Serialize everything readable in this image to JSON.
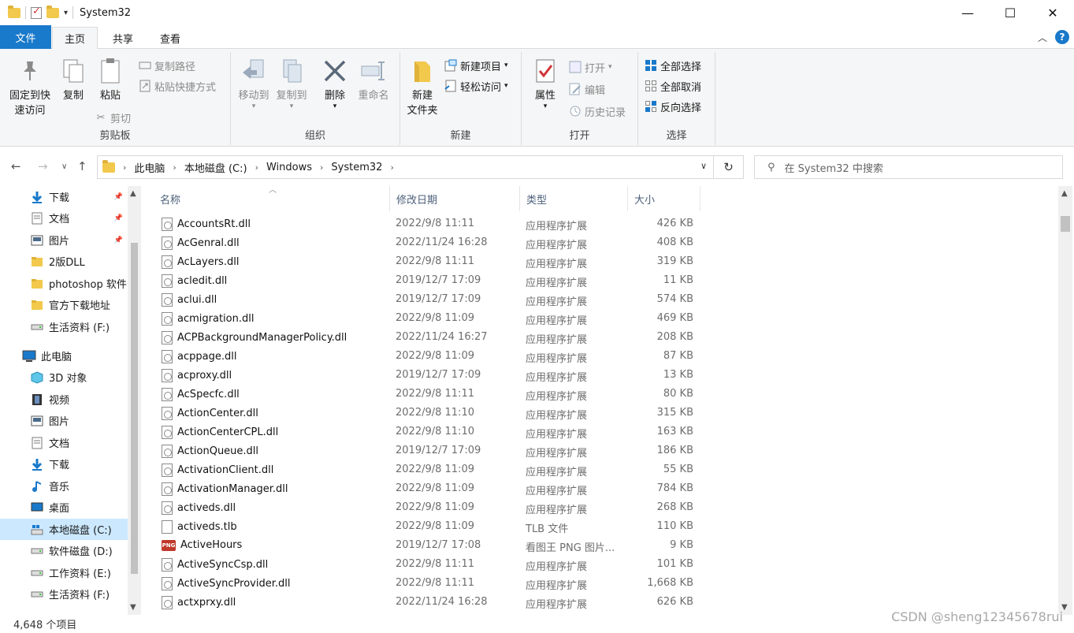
{
  "window": {
    "title": "System32",
    "controls": [
      "—",
      "☐",
      "✕"
    ]
  },
  "ribbon_tabs": {
    "file": "文件",
    "home": "主页",
    "share": "共享",
    "view": "查看"
  },
  "ribbon": {
    "clipboard": {
      "label": "剪贴板",
      "pin": "固定到快",
      "pin2": "速访问",
      "copy": "复制",
      "paste": "粘贴",
      "copy_path": "复制路径",
      "paste_shortcut": "粘贴快捷方式",
      "cut": "剪切"
    },
    "organize": {
      "label": "组织",
      "move_to": "移动到",
      "copy_to": "复制到",
      "delete": "删除",
      "rename": "重命名"
    },
    "new": {
      "label": "新建",
      "new_folder": "新建",
      "new_folder2": "文件夹",
      "new_item": "新建项目",
      "easy_access": "轻松访问"
    },
    "open": {
      "label": "打开",
      "properties": "属性",
      "open": "打开",
      "edit": "编辑",
      "history": "历史记录"
    },
    "select": {
      "label": "选择",
      "select_all": "全部选择",
      "select_none": "全部取消",
      "invert": "反向选择"
    }
  },
  "address": {
    "crumbs": [
      "此电脑",
      "本地磁盘 (C:)",
      "Windows",
      "System32"
    ],
    "search_placeholder": "在 System32 中搜索"
  },
  "navpane": {
    "items": [
      {
        "label": "下载",
        "icon": "download-arrow-icon",
        "pinned": true,
        "indent": 1
      },
      {
        "label": "文档",
        "icon": "document-icon",
        "pinned": true,
        "indent": 1
      },
      {
        "label": "图片",
        "icon": "picture-icon",
        "pinned": true,
        "indent": 1
      },
      {
        "label": "2版DLL",
        "icon": "folder-icon",
        "pinned": false,
        "indent": 1
      },
      {
        "label": "photoshop 软件",
        "icon": "folder-icon",
        "pinned": false,
        "indent": 1
      },
      {
        "label": "官方下载地址",
        "icon": "folder-icon",
        "pinned": false,
        "indent": 1
      },
      {
        "label": "生活资料 (F:)",
        "icon": "drive-icon",
        "pinned": false,
        "indent": 1
      },
      {
        "label": "此电脑",
        "icon": "computer-icon",
        "pinned": false,
        "indent": 0
      },
      {
        "label": "3D 对象",
        "icon": "cube-icon",
        "pinned": false,
        "indent": 1
      },
      {
        "label": "视频",
        "icon": "video-icon",
        "pinned": false,
        "indent": 1
      },
      {
        "label": "图片",
        "icon": "picture-icon",
        "pinned": false,
        "indent": 1
      },
      {
        "label": "文档",
        "icon": "document-icon",
        "pinned": false,
        "indent": 1
      },
      {
        "label": "下载",
        "icon": "download-arrow-icon",
        "pinned": false,
        "indent": 1
      },
      {
        "label": "音乐",
        "icon": "music-note-icon",
        "pinned": false,
        "indent": 1
      },
      {
        "label": "桌面",
        "icon": "desktop-icon",
        "pinned": false,
        "indent": 1
      },
      {
        "label": "本地磁盘 (C:)",
        "icon": "windows-drive-icon",
        "pinned": false,
        "indent": 1,
        "selected": true
      },
      {
        "label": "软件磁盘 (D:)",
        "icon": "drive-icon",
        "pinned": false,
        "indent": 1
      },
      {
        "label": "工作资料 (E:)",
        "icon": "drive-icon",
        "pinned": false,
        "indent": 1
      },
      {
        "label": "生活资料 (F:)",
        "icon": "drive-icon",
        "pinned": false,
        "indent": 1
      }
    ]
  },
  "columns": {
    "name": "名称",
    "date": "修改日期",
    "type": "类型",
    "size": "大小"
  },
  "files": [
    {
      "name": "AccountsRt.dll",
      "date": "2022/9/8 11:11",
      "type": "应用程序扩展",
      "size": "426 KB",
      "icon": "dll"
    },
    {
      "name": "AcGenral.dll",
      "date": "2022/11/24 16:28",
      "type": "应用程序扩展",
      "size": "408 KB",
      "icon": "dll"
    },
    {
      "name": "AcLayers.dll",
      "date": "2022/9/8 11:11",
      "type": "应用程序扩展",
      "size": "319 KB",
      "icon": "dll"
    },
    {
      "name": "acledit.dll",
      "date": "2019/12/7 17:09",
      "type": "应用程序扩展",
      "size": "11 KB",
      "icon": "dll"
    },
    {
      "name": "aclui.dll",
      "date": "2019/12/7 17:09",
      "type": "应用程序扩展",
      "size": "574 KB",
      "icon": "dll"
    },
    {
      "name": "acmigration.dll",
      "date": "2022/9/8 11:09",
      "type": "应用程序扩展",
      "size": "469 KB",
      "icon": "dll"
    },
    {
      "name": "ACPBackgroundManagerPolicy.dll",
      "date": "2022/11/24 16:27",
      "type": "应用程序扩展",
      "size": "208 KB",
      "icon": "dll"
    },
    {
      "name": "acppage.dll",
      "date": "2022/9/8 11:09",
      "type": "应用程序扩展",
      "size": "87 KB",
      "icon": "dll"
    },
    {
      "name": "acproxy.dll",
      "date": "2019/12/7 17:09",
      "type": "应用程序扩展",
      "size": "13 KB",
      "icon": "dll"
    },
    {
      "name": "AcSpecfc.dll",
      "date": "2022/9/8 11:11",
      "type": "应用程序扩展",
      "size": "80 KB",
      "icon": "dll"
    },
    {
      "name": "ActionCenter.dll",
      "date": "2022/9/8 11:10",
      "type": "应用程序扩展",
      "size": "315 KB",
      "icon": "dll"
    },
    {
      "name": "ActionCenterCPL.dll",
      "date": "2022/9/8 11:10",
      "type": "应用程序扩展",
      "size": "163 KB",
      "icon": "dll"
    },
    {
      "name": "ActionQueue.dll",
      "date": "2019/12/7 17:09",
      "type": "应用程序扩展",
      "size": "186 KB",
      "icon": "dll"
    },
    {
      "name": "ActivationClient.dll",
      "date": "2022/9/8 11:09",
      "type": "应用程序扩展",
      "size": "55 KB",
      "icon": "dll"
    },
    {
      "name": "ActivationManager.dll",
      "date": "2022/9/8 11:09",
      "type": "应用程序扩展",
      "size": "784 KB",
      "icon": "dll"
    },
    {
      "name": "activeds.dll",
      "date": "2022/9/8 11:09",
      "type": "应用程序扩展",
      "size": "268 KB",
      "icon": "dll"
    },
    {
      "name": "activeds.tlb",
      "date": "2022/9/8 11:09",
      "type": "TLB 文件",
      "size": "110 KB",
      "icon": "tlb"
    },
    {
      "name": "ActiveHours",
      "date": "2019/12/7 17:08",
      "type": "看图王 PNG 图片...",
      "size": "9 KB",
      "icon": "png"
    },
    {
      "name": "ActiveSyncCsp.dll",
      "date": "2022/9/8 11:11",
      "type": "应用程序扩展",
      "size": "101 KB",
      "icon": "dll"
    },
    {
      "name": "ActiveSyncProvider.dll",
      "date": "2022/9/8 11:11",
      "type": "应用程序扩展",
      "size": "1,668 KB",
      "icon": "dll"
    },
    {
      "name": "actxprxy.dll",
      "date": "2022/11/24 16:28",
      "type": "应用程序扩展",
      "size": "626 KB",
      "icon": "dll"
    }
  ],
  "status": {
    "item_count": "4,648 个项目"
  },
  "watermark": "CSDN @sheng12345678rui",
  "colors": {
    "accent": "#1979ca",
    "selection": "#cce8ff",
    "folder": "#f2c94c"
  }
}
